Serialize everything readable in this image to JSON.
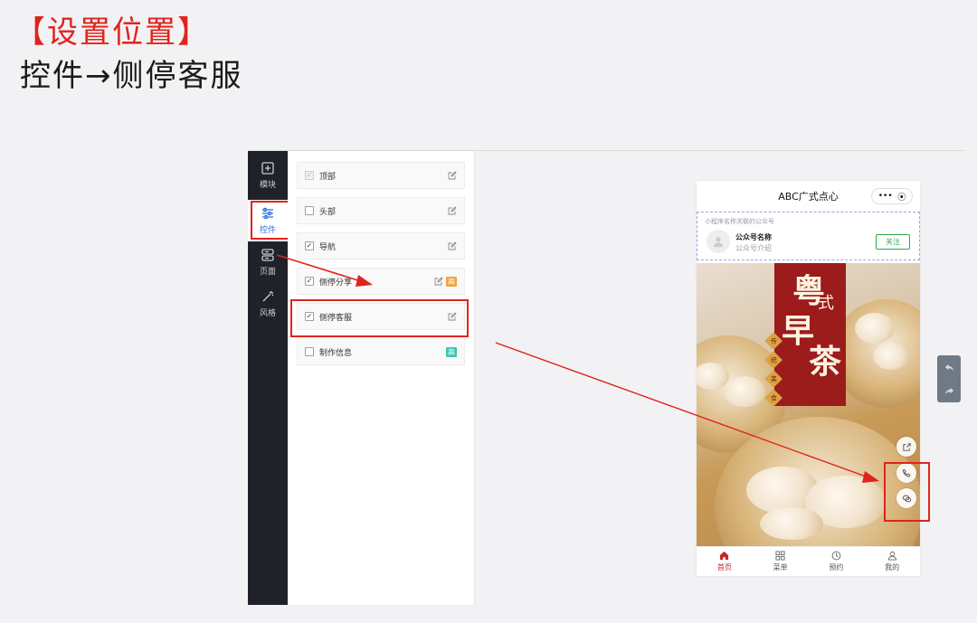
{
  "heading": {
    "line1": "【设置位置】",
    "line2": "控件→侧停客服"
  },
  "rail": {
    "items": [
      {
        "label": "模块",
        "icon": "plus-square-icon"
      },
      {
        "label": "控件",
        "icon": "sliders-icon",
        "active": true
      },
      {
        "label": "页面",
        "icon": "page-stack-icon"
      },
      {
        "label": "风格",
        "icon": "magic-wand-icon"
      }
    ]
  },
  "controls": {
    "items": [
      {
        "label": "顶部",
        "checked": true,
        "disabled": true
      },
      {
        "label": "头部",
        "checked": false
      },
      {
        "label": "导航",
        "checked": true
      },
      {
        "label": "侧停分享",
        "checked": true,
        "badge": "高"
      },
      {
        "label": "侧停客服",
        "checked": true
      },
      {
        "label": "制作信息",
        "checked": false,
        "badge": "高"
      }
    ]
  },
  "colors": {
    "accent_red": "#e0231d",
    "rail_bg": "#1f2329",
    "active_blue": "#2f6fe4",
    "badge_orange": "#f0a33c",
    "badge_teal": "#3cc4b4",
    "follow_green": "#2fa84f",
    "tab_active": "#c72525"
  },
  "phone": {
    "title": "ABC广式点心",
    "capsule_more": "•••",
    "capsule_close": "⦿",
    "official": {
      "tip": "小程序名称关联的公众号",
      "name": "公众号名称",
      "intro": "公众号介绍",
      "follow": "关注"
    },
    "banner": {
      "c1": "粤",
      "c2": "式",
      "c3": "早",
      "c4": "茶",
      "tags": [
        "传",
        "统",
        "美",
        "食"
      ]
    },
    "tabs": [
      {
        "label": "首页",
        "icon": "home-icon",
        "active": true
      },
      {
        "label": "菜单",
        "icon": "grid-icon"
      },
      {
        "label": "预约",
        "icon": "clock-icon"
      },
      {
        "label": "我的",
        "icon": "user-icon"
      }
    ]
  }
}
